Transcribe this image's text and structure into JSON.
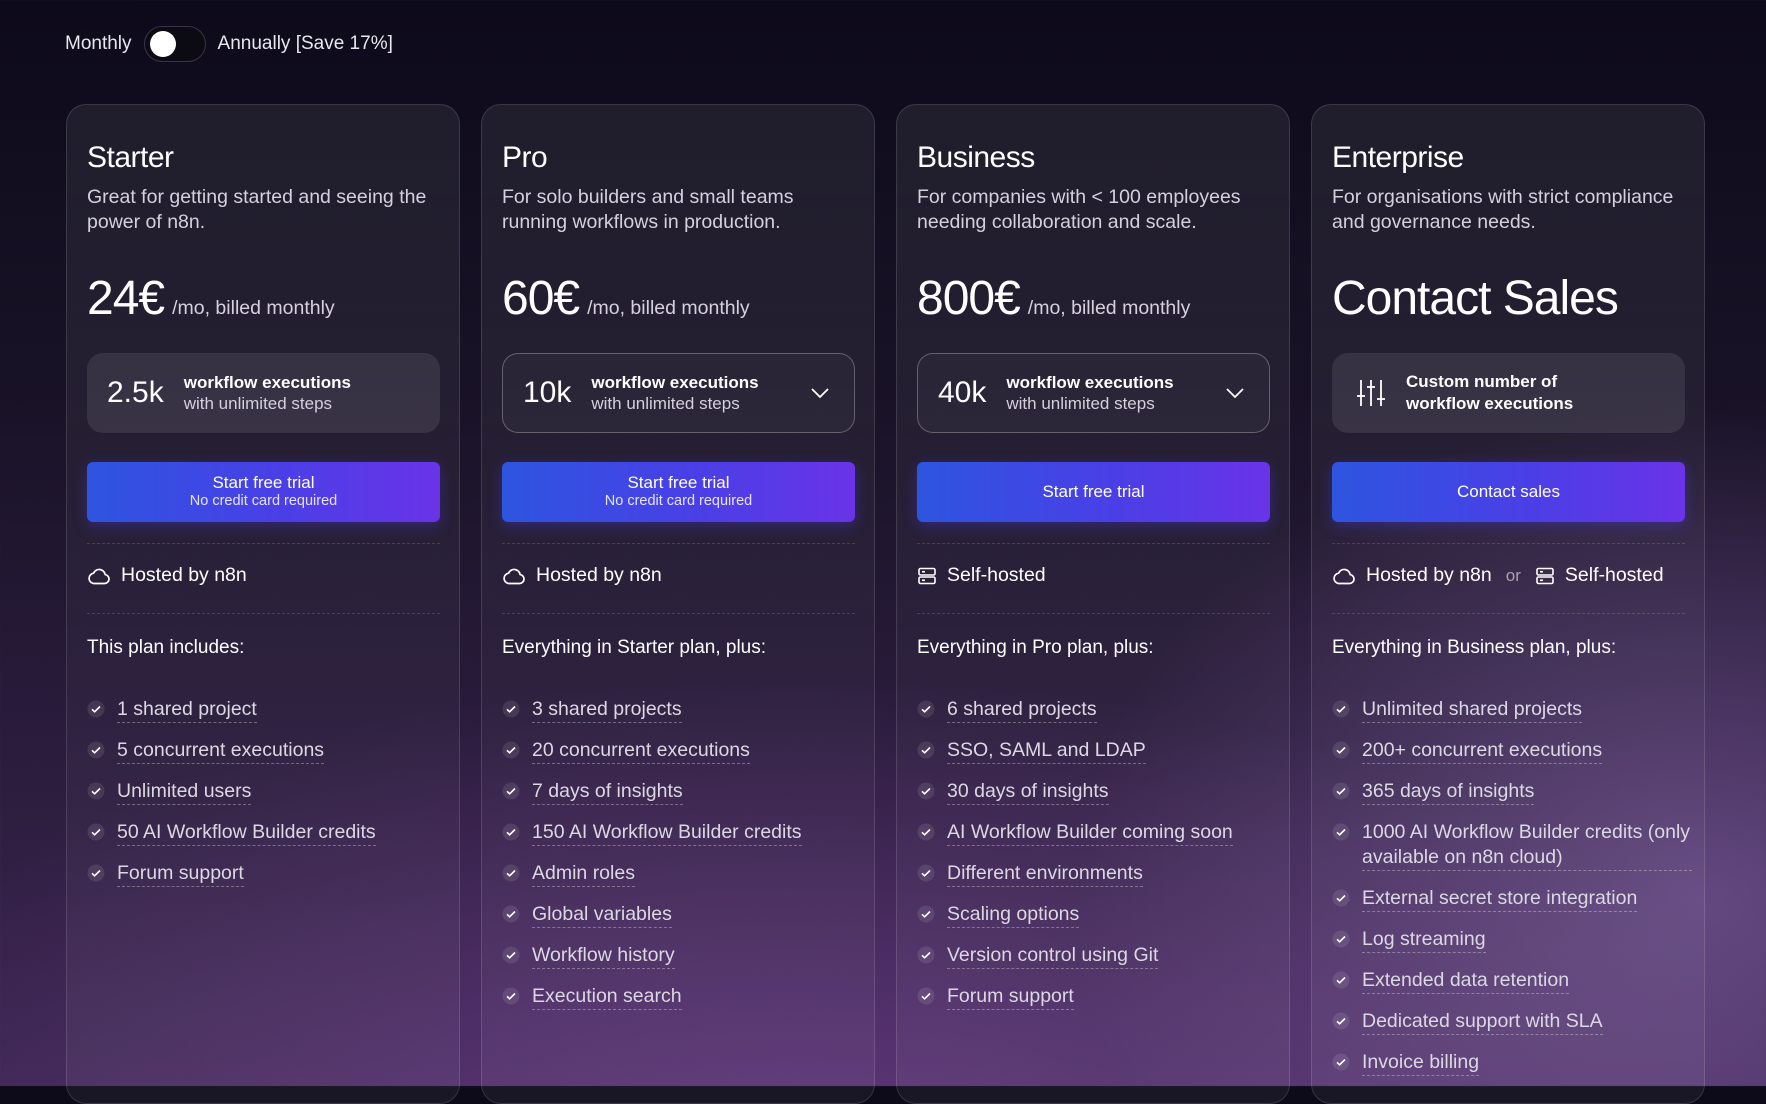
{
  "billing_toggle": {
    "monthly_label": "Monthly",
    "annual_label": "Annually [Save 17%]"
  },
  "colors": {
    "cta_start": "#2d55e0",
    "cta_end": "#6a33e8",
    "background": "#181226"
  },
  "plans": [
    {
      "name": "Starter",
      "description": "Great for getting started and seeing the power of n8n.",
      "price": "24€",
      "price_unit": "/mo, billed monthly",
      "executions": {
        "count": "2.5k",
        "line1": "workflow executions",
        "line2": "with unlimited steps"
      },
      "cta": {
        "label": "Start free trial",
        "sublabel": "No credit card required"
      },
      "hosting": {
        "label": "Hosted by n8n"
      },
      "includes_heading": "This plan includes:",
      "features": [
        "1 shared project",
        "5 concurrent executions",
        "Unlimited users",
        "50 AI Workflow Builder credits",
        "Forum support"
      ]
    },
    {
      "name": "Pro",
      "description": "For solo builders and small teams running workflows in production.",
      "price": "60€",
      "price_unit": "/mo, billed monthly",
      "executions": {
        "count": "10k",
        "line1": "workflow executions",
        "line2": "with unlimited steps"
      },
      "cta": {
        "label": "Start free trial",
        "sublabel": "No credit card required"
      },
      "hosting": {
        "label": "Hosted by n8n"
      },
      "includes_heading": "Everything in Starter plan, plus:",
      "features": [
        "3 shared projects",
        "20 concurrent executions",
        "7 days of insights",
        "150 AI Workflow Builder credits",
        "Admin roles",
        "Global variables",
        "Workflow history",
        "Execution search"
      ]
    },
    {
      "name": "Business",
      "description": "For companies with < 100 employees needing collaboration and scale.",
      "price": "800€",
      "price_unit": "/mo, billed monthly",
      "executions": {
        "count": "40k",
        "line1": "workflow executions",
        "line2": "with unlimited steps"
      },
      "cta": {
        "label": "Start free trial"
      },
      "hosting": {
        "label": "Self-hosted"
      },
      "includes_heading": "Everything in Pro plan, plus:",
      "features": [
        "6 shared projects",
        "SSO, SAML and LDAP",
        "30 days of insights",
        "AI Workflow Builder coming soon",
        "Different environments",
        "Scaling options",
        "Version control using Git",
        "Forum support"
      ]
    },
    {
      "name": "Enterprise",
      "description": "For organisations with strict compliance and governance needs.",
      "price": "Contact Sales",
      "executions": {
        "line1": "Custom number of",
        "line2": "workflow executions"
      },
      "cta": {
        "label": "Contact sales"
      },
      "hosting": {
        "label": "Hosted by n8n",
        "or": "or",
        "label2": "Self-hosted"
      },
      "includes_heading": "Everything in Business plan, plus:",
      "features": [
        "Unlimited shared projects",
        "200+ concurrent executions",
        "365 days of insights",
        "1000 AI Workflow Builder credits (only available on n8n cloud)",
        "External secret store integration",
        "Log streaming",
        "Extended data retention",
        "Dedicated support with SLA",
        "Invoice billing"
      ]
    }
  ]
}
